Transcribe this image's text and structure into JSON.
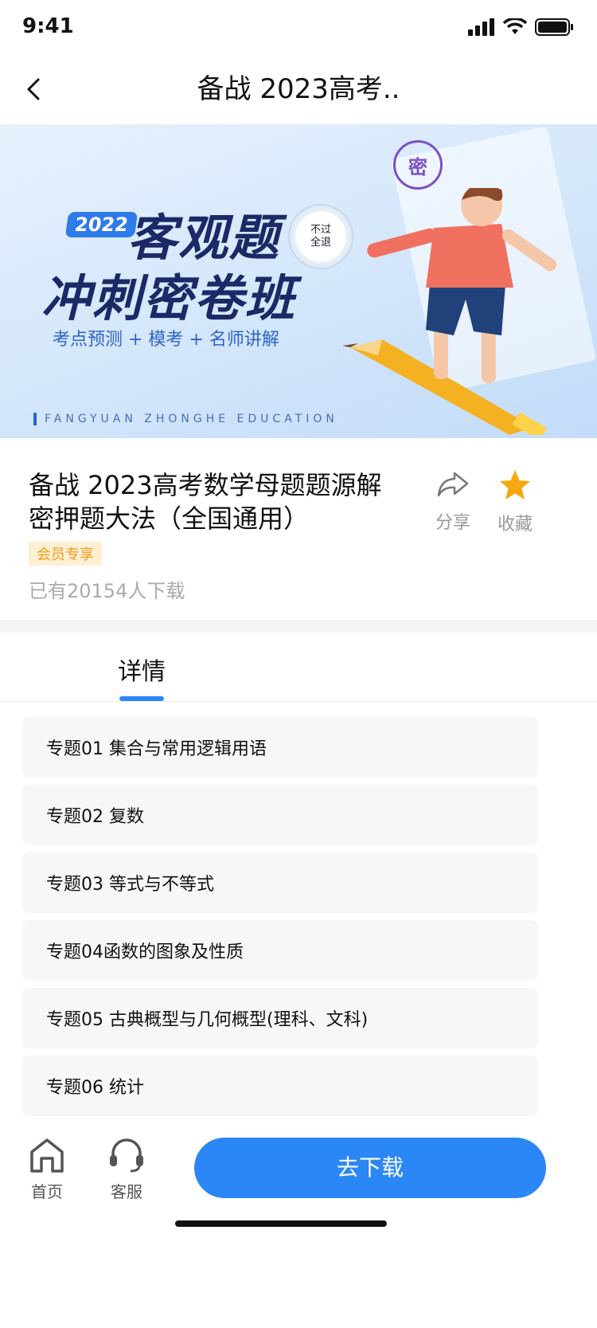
{
  "status_bar": {
    "time": "9:41"
  },
  "nav": {
    "title": "备战 2023高考.."
  },
  "banner": {
    "year": "2022",
    "title_line1": "客观题",
    "title_line2": "冲刺密卷班",
    "subtitle": "考点预测 + 模考 + 名师讲解",
    "brand": "FANGYUAN ZHONGHE EDUCATION",
    "seal_line1": "不过",
    "seal_line2": "全退",
    "stamp": "密"
  },
  "product": {
    "title": "备战 2023高考数学母题题源解密押题大法（全国通用）",
    "badge": "会员专享",
    "downloads": "已有20154人下载",
    "share_label": "分享",
    "favorite_label": "收藏"
  },
  "tabs": [
    {
      "label": "详情"
    }
  ],
  "topics": [
    "专题01 集合与常用逻辑用语",
    "专题02 复数",
    "专题03 等式与不等式",
    "专题04函数的图象及性质",
    "专题05 古典概型与几何概型(理科、文科)",
    "专题06 统计"
  ],
  "bottom_bar": {
    "home_label": "首页",
    "service_label": "客服",
    "download_label": "去下载"
  },
  "colors": {
    "accent": "#2b87f5",
    "badge_bg": "#fff0d3",
    "badge_text": "#f29a18",
    "star": "#f7a614"
  }
}
